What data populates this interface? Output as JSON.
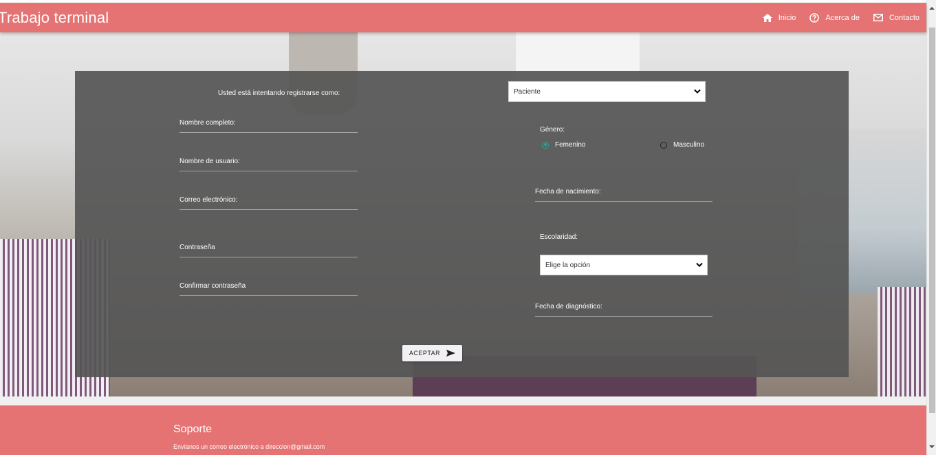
{
  "navbar": {
    "brand": "Trabajo terminal",
    "items": [
      {
        "label": "Inicio",
        "icon": "home-icon"
      },
      {
        "label": "Acerca de",
        "icon": "help-circle-icon"
      },
      {
        "label": "Contacto",
        "icon": "mail-icon"
      }
    ]
  },
  "form": {
    "register_as_label": "Usted está intentando registrarse como:",
    "register_as_value": "Paciente",
    "left_fields": [
      {
        "label": "Nombre completo:"
      },
      {
        "label": "Nombre de usuario:"
      },
      {
        "label": "Correo electrónico:"
      },
      {
        "label": "Contraseña"
      },
      {
        "label": "Confirmar contraseña"
      }
    ],
    "gender": {
      "label": "Género:",
      "options": [
        "Femenino",
        "Masculino"
      ],
      "selected": "Femenino"
    },
    "birthdate_label": "Fecha de nacimiento:",
    "education": {
      "label": "Escolaridad:",
      "value": "Elige la opción"
    },
    "diagnosis_date_label": "Fecha de diagnóstico:",
    "submit_label": "ACEPTAR"
  },
  "footer": {
    "title": "Soporte",
    "text": "Envíanos un correo electrónico a direccion@gmail.com"
  },
  "colors": {
    "primary": "#e57373",
    "panel": "#555555",
    "radio_accent": "#26a69a"
  }
}
